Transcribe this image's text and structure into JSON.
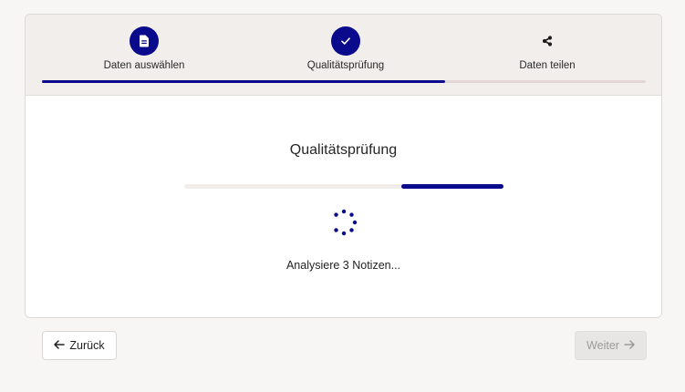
{
  "stepper": {
    "steps": [
      {
        "label": "Daten auswählen",
        "icon": "document-icon",
        "state": "done"
      },
      {
        "label": "Qualitätsprüfung",
        "icon": "check-icon",
        "state": "active"
      },
      {
        "label": "Daten teilen",
        "icon": "share-icon",
        "state": "pending"
      }
    ],
    "progress_fraction": 0.667
  },
  "main": {
    "title": "Qualitätsprüfung",
    "progress_percent": 32,
    "status": "Analysiere 3 Notizen..."
  },
  "footer": {
    "back_label": "Zurück",
    "next_label": "Weiter"
  },
  "colors": {
    "accent": "#0a0a8c",
    "stepper_bg": "#f1eeeb",
    "page_bg": "#f7f6f4"
  }
}
